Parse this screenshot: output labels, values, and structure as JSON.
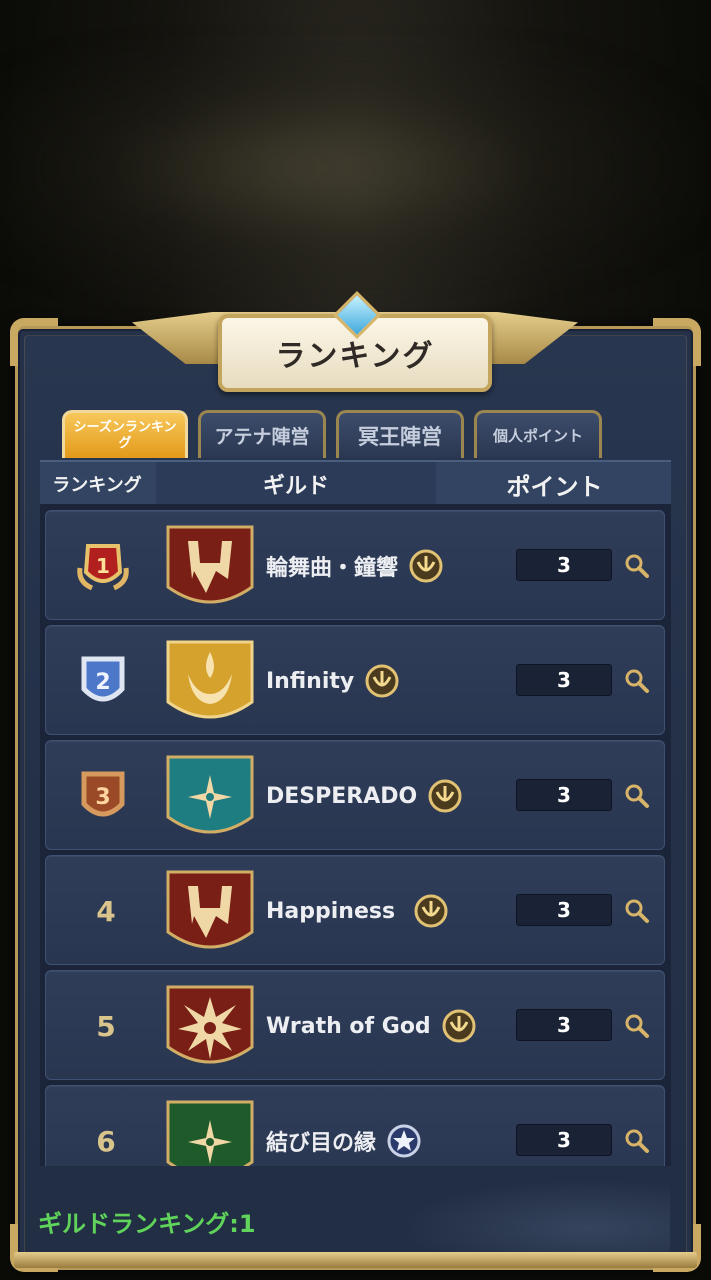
{
  "title": "ランキング",
  "tabs": [
    {
      "label": "シーズンランキング",
      "active": true
    },
    {
      "label": "アテナ陣営",
      "active": false
    },
    {
      "label": "冥王陣営",
      "active": false
    },
    {
      "label": "個人ポイント",
      "active": false
    }
  ],
  "columns": {
    "rank": "ランキング",
    "guild": "ギルド",
    "points": "ポイント"
  },
  "rows": [
    {
      "rank": "1",
      "name": "輪舞曲・鐘響",
      "points": "3",
      "emblem": "red-throne-emblem",
      "rank_icon": "gold-crest-icon"
    },
    {
      "rank": "2",
      "name": "Infinity",
      "points": "3",
      "emblem": "gold-flame-emblem",
      "rank_icon": "gold-crest-icon"
    },
    {
      "rank": "3",
      "name": "DESPERADO",
      "points": "3",
      "emblem": "teal-star-emblem",
      "rank_icon": "gold-crest-icon"
    },
    {
      "rank": "4",
      "name": "Happiness",
      "points": "3",
      "emblem": "red-throne-emblem",
      "rank_icon": "gold-crest-icon"
    },
    {
      "rank": "5",
      "name": "Wrath of God",
      "points": "3",
      "emblem": "red-burst-emblem",
      "rank_icon": "gold-crest-icon"
    },
    {
      "rank": "6",
      "name": "結び目の縁",
      "points": "3",
      "emblem": "green-star-emblem",
      "rank_icon": "silver-star-icon"
    }
  ],
  "footer": "ギルドランキング:1",
  "colors": {
    "panel": "#243149",
    "gold": "#c9a862",
    "active_tab": "#e39a1a",
    "footer_text": "#5fd35a"
  }
}
